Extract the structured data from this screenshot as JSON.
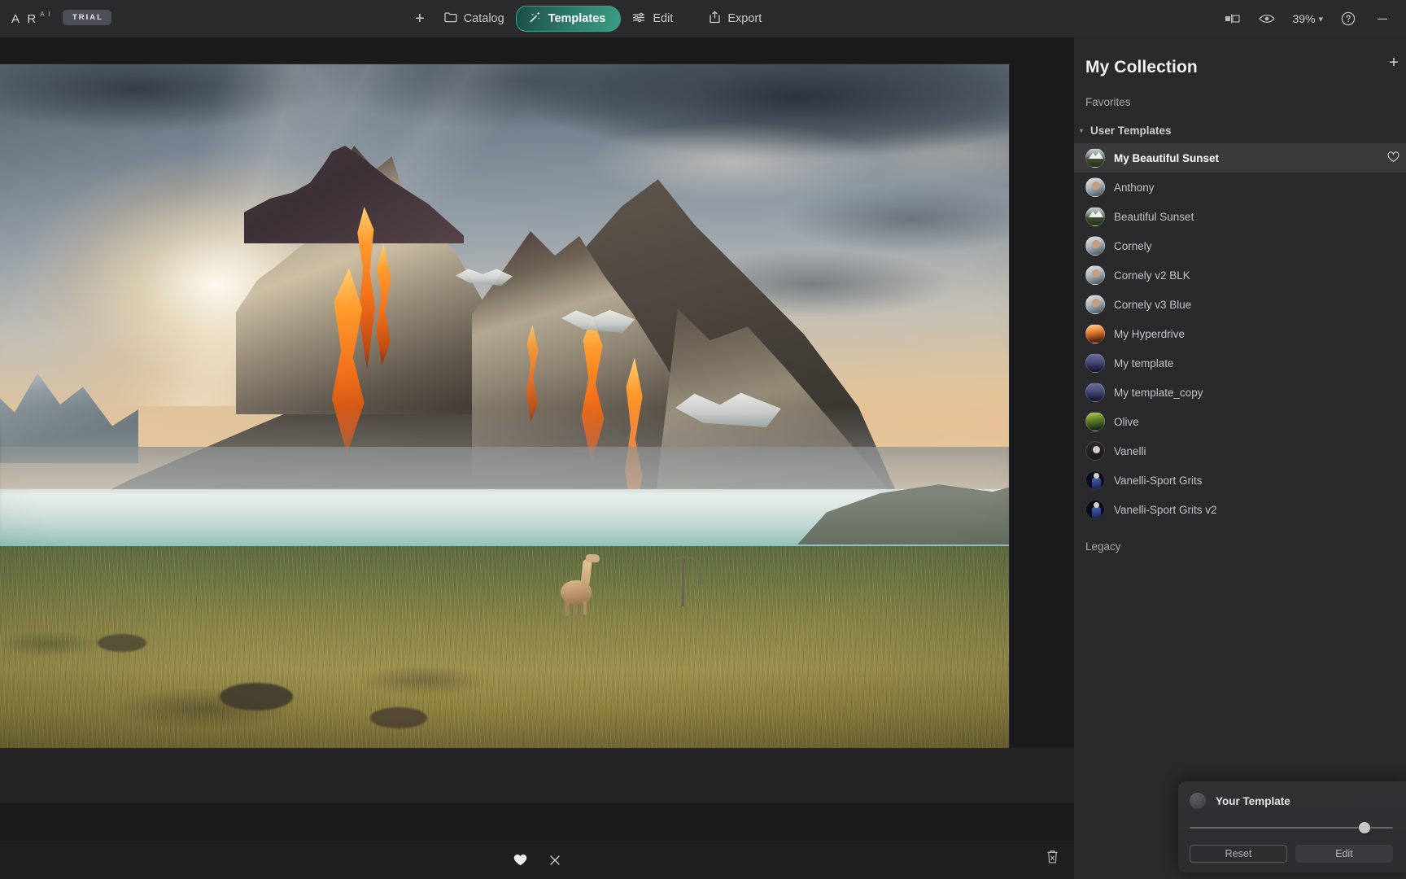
{
  "app": {
    "brand": "A R",
    "brand_sup": "A I",
    "trial_badge": "TRIAL"
  },
  "toolbar": {
    "add_label": "+",
    "add_icon": "plus-icon",
    "items": [
      {
        "label": "Catalog",
        "icon": "folder-icon",
        "active": false
      },
      {
        "label": "Templates",
        "icon": "magic-wand-icon",
        "active": true
      },
      {
        "label": "Edit",
        "icon": "sliders-icon",
        "active": false
      },
      {
        "label": "Export",
        "icon": "share-upload-icon",
        "active": false
      }
    ],
    "compare_icon": "compare-view-icon",
    "preview_icon": "eye-icon",
    "zoom_value": "39%",
    "zoom_chevron": "▾",
    "help_icon": "help-circle-icon",
    "minimize_label": "—"
  },
  "canvas": {
    "bottom_actions": [
      {
        "name": "favorite",
        "icon": "heart-filled-icon"
      },
      {
        "name": "reject",
        "icon": "close-x-icon"
      }
    ],
    "delete_icon": "trash-x-icon"
  },
  "panel": {
    "title": "My Collection",
    "add_label": "+",
    "favorites_label": "Favorites",
    "group_label": "User Templates",
    "group_caret": "▾",
    "legacy_label": "Legacy",
    "templates": [
      {
        "label": "My Beautiful Sunset",
        "thumb": "t-mountain",
        "selected": true
      },
      {
        "label": "Anthony",
        "thumb": "t-person",
        "selected": false
      },
      {
        "label": "Beautiful Sunset",
        "thumb": "t-mountain",
        "selected": false
      },
      {
        "label": "Cornely",
        "thumb": "t-person",
        "selected": false
      },
      {
        "label": "Cornely v2 BLK",
        "thumb": "t-person",
        "selected": false
      },
      {
        "label": "Cornely v3 Blue",
        "thumb": "t-person",
        "selected": false
      },
      {
        "label": "My Hyperdrive",
        "thumb": "t-hyper",
        "selected": false
      },
      {
        "label": "My template",
        "thumb": "t-night",
        "selected": false
      },
      {
        "label": "My template_copy",
        "thumb": "t-night",
        "selected": false
      },
      {
        "label": "Olive",
        "thumb": "t-olive",
        "selected": false
      },
      {
        "label": "Vanelli",
        "thumb": "t-vanelli",
        "selected": false
      },
      {
        "label": "Vanelli-Sport Grits",
        "thumb": "t-sport",
        "selected": false
      },
      {
        "label": "Vanelli-Sport Grits v2",
        "thumb": "t-sport",
        "selected": false
      }
    ]
  },
  "template_card": {
    "name": "Your Template",
    "slider_percent": 86,
    "reset_label": "Reset",
    "edit_label": "Edit"
  },
  "colors": {
    "accent_teal": "#3d9c85",
    "panel_bg": "#2a2a2c",
    "toolbar_bg": "#2b2b2e",
    "selected_row": "#3a3a3d"
  }
}
